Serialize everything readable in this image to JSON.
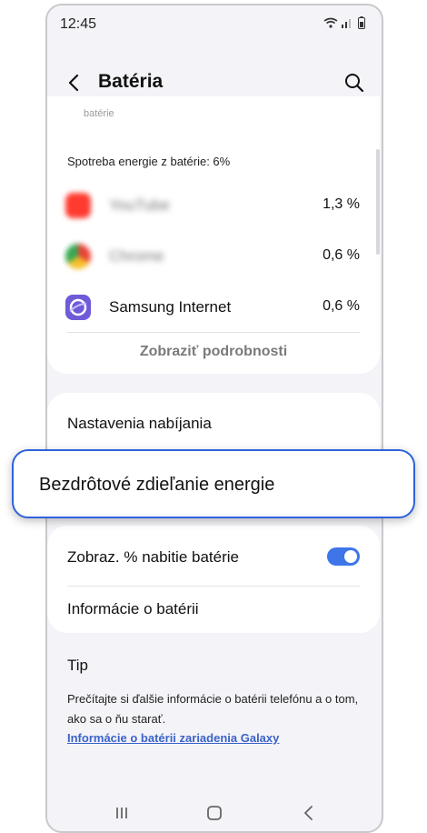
{
  "status_bar": {
    "time": "12:45"
  },
  "header": {
    "title": "Batéria"
  },
  "usage": {
    "faded_text": "batérie",
    "title": "Spotreba energie z batérie: 6%",
    "apps": [
      {
        "name": "YouTube",
        "percent": "1,3 %",
        "icon_color": "#ff3b30"
      },
      {
        "name": "Chrome",
        "percent": "0,6 %",
        "icon_color": "#e8b73a"
      },
      {
        "name": "Samsung Internet",
        "percent": "0,6 %",
        "icon_color": "#6e5bd8"
      }
    ],
    "details_label": "Zobraziť podrobnosti"
  },
  "settings": {
    "charging": "Nastavenia nabíjania",
    "wireless_share": "Bezdrôtové zdieľanie energie",
    "show_percent": "Zobraz. % nabitie batérie",
    "show_percent_on": true,
    "battery_info": "Informácie o batérii"
  },
  "tip": {
    "title": "Tip",
    "text": "Prečítajte si ďalšie informácie o batérii telefónu a o tom, ako sa o ňu starať.",
    "link": "Informácie o batérii zariadenia Galaxy"
  },
  "colors": {
    "accent": "#3e75e8",
    "highlight_border": "#2f62db",
    "link": "#3b63c9"
  }
}
